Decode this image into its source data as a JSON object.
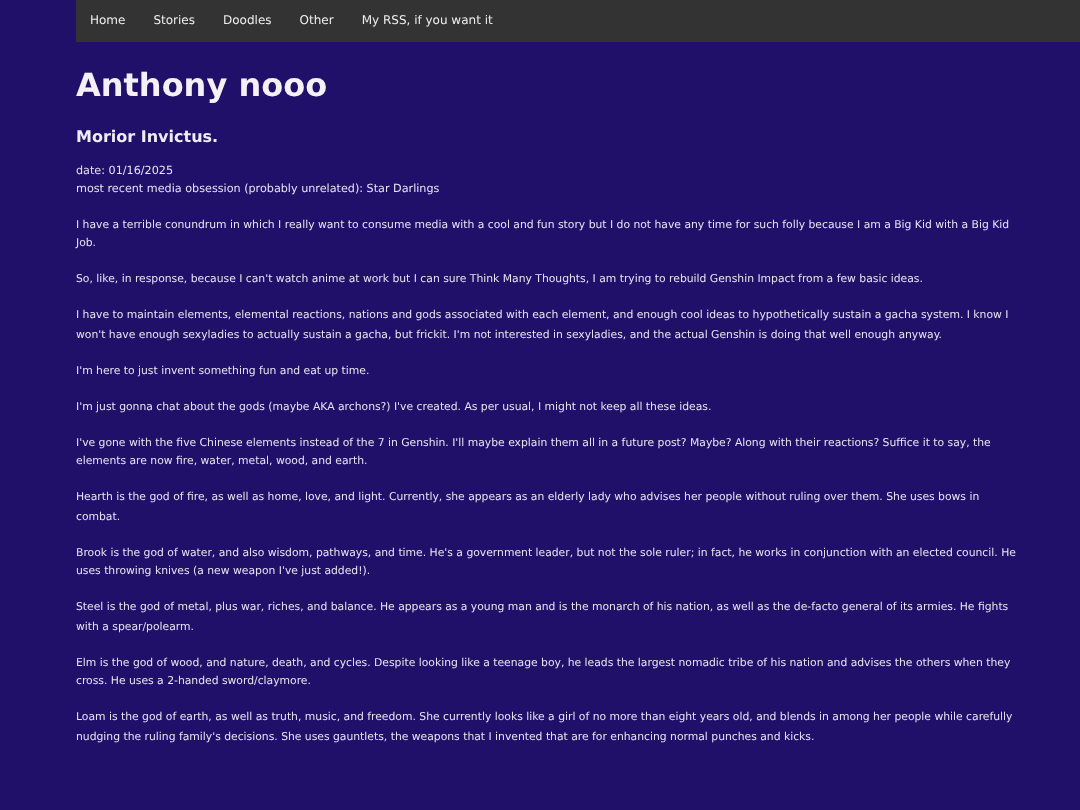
{
  "nav": {
    "items": [
      {
        "label": "Home"
      },
      {
        "label": "Stories"
      },
      {
        "label": "Doodles"
      },
      {
        "label": "Other"
      },
      {
        "label": "My RSS, if you want it"
      }
    ]
  },
  "title": "Anthony nooo",
  "subtitle": "Morior Invictus.",
  "meta": [
    "date: 01/16/2025",
    "most recent media obsession (probably unrelated): Star Darlings"
  ],
  "paragraphs": [
    "I have a terrible conundrum in which I really want to consume media with a cool and fun story but I do not have any time for such folly because I am a Big Kid with a Big Kid Job.",
    "So, like, in response, because I can't watch anime at work but I can sure Think Many Thoughts, I am trying to rebuild Genshin Impact from a few basic ideas.",
    "I have to maintain elements, elemental reactions, nations and gods associated with each element, and enough cool ideas to hypothetically sustain a gacha system. I know I won't have enough sexyladies to actually sustain a gacha, but frickit. I'm not interested in sexyladies, and the actual Genshin is doing that well enough anyway.",
    "I'm here to just invent something fun and eat up time.",
    "I'm just gonna chat about the gods (maybe AKA archons?) I've created. As per usual, I might not keep all these ideas.",
    "I've gone with the five Chinese elements instead of the 7 in Genshin. I'll maybe explain them all in a future post? Maybe? Along with their reactions? Suffice it to say, the elements are now fire, water, metal, wood, and earth.",
    "Hearth is the god of fire, as well as home, love, and light. Currently, she appears as an elderly lady who advises her people without ruling over them. She uses bows in combat.",
    "Brook is the god of water, and also wisdom, pathways, and time. He's a government leader, but not the sole ruler; in fact, he works in conjunction with an elected council. He uses throwing knives (a new weapon I've just added!).",
    "Steel is the god of metal, plus war, riches, and balance. He appears as a young man and is the monarch of his nation, as well as the de-facto general of its armies. He fights with a spear/polearm.",
    "Elm is the god of wood, and nature, death, and cycles. Despite looking like a teenage boy, he leads the largest nomadic tribe of his nation and advises the others when they cross. He uses a 2-handed sword/claymore.",
    "Loam is the god of earth, as well as truth, music, and freedom. She currently looks like a girl of no more than eight years old, and blends in among her people while carefully nudging the ruling family's decisions. She uses gauntlets, the weapons that I invented that are for enhancing normal punches and kicks."
  ]
}
